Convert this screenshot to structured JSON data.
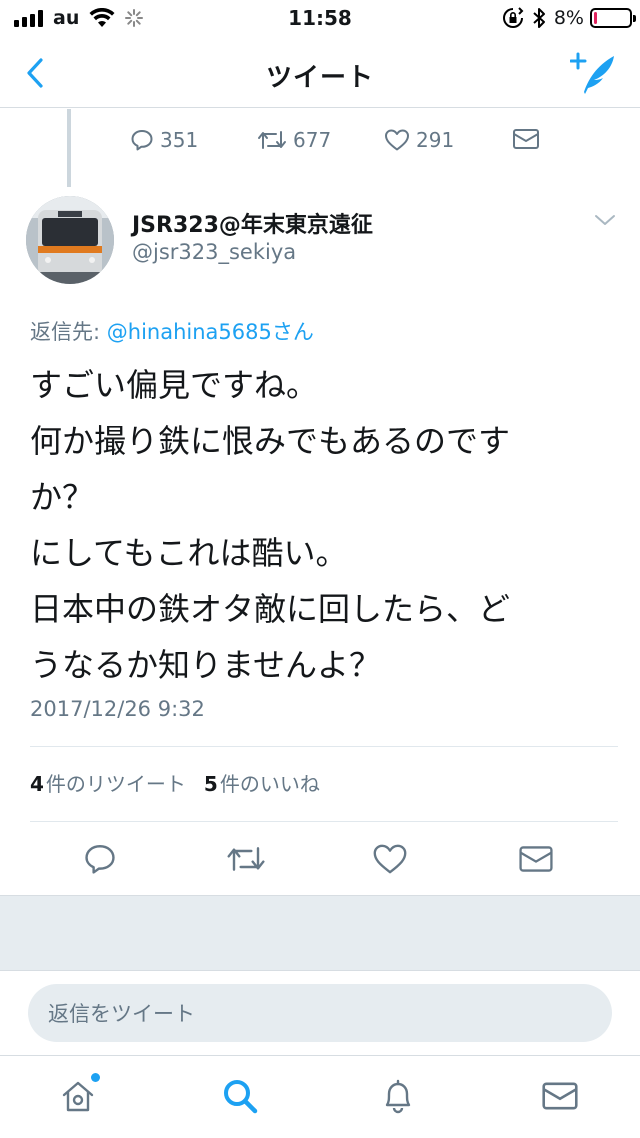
{
  "status_bar": {
    "carrier": "au",
    "time": "11:58",
    "battery_percent": "8%",
    "battery_level": 0.08,
    "icons": [
      "signal-icon",
      "wifi-icon",
      "loading-icon",
      "orientation-lock-icon",
      "bluetooth-icon",
      "battery-icon"
    ]
  },
  "nav": {
    "title": "ツイート",
    "back_icon": "chevron-left-icon",
    "compose_icon": "compose-tweet-icon"
  },
  "previous_tweet": {
    "replies": "351",
    "retweets": "677",
    "likes": "291"
  },
  "tweet": {
    "author_name": "JSR323@年末東京遠征",
    "author_handle": "@jsr323_sekiya",
    "reply_label": "返信先: ",
    "reply_mention": "@hinahina5685さん",
    "text_lines": [
      "すごい偏見ですね。",
      "何か撮り鉄に恨みでもあるのです",
      "か？",
      "にしてもこれは酷い。",
      "日本中の鉄オタ敵に回したら、ど",
      "うなるか知りませんよ？"
    ],
    "timestamp": "2017/12/26 9:32",
    "retweet_count": "4",
    "retweet_label": "件のリツイート",
    "like_count": "5",
    "like_label": "件のいいね"
  },
  "reply_bar": {
    "placeholder": "返信をツイート"
  },
  "tab_bar": {
    "items": [
      "home-icon",
      "search-icon",
      "notifications-icon",
      "messages-icon"
    ]
  },
  "colors": {
    "accent": "#1da1f2",
    "muted": "#657786",
    "text": "#14171a",
    "battery_low": "#e0245e",
    "separator_bg": "#e6ecf0"
  }
}
